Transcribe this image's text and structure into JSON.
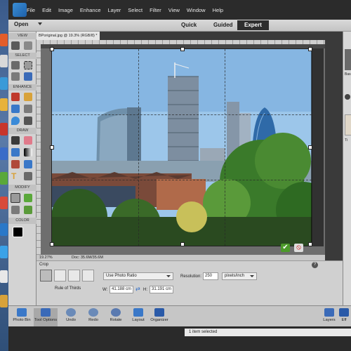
{
  "menu": [
    "File",
    "Edit",
    "Image",
    "Enhance",
    "Layer",
    "Select",
    "Filter",
    "View",
    "Window",
    "Help"
  ],
  "modebar": {
    "open": "Open",
    "quick": "Quick",
    "guided": "Guided",
    "expert": "Expert"
  },
  "panels": {
    "view": "VIEW",
    "select": "SELECT",
    "enhance": "ENHANCE",
    "draw": "DRAW",
    "modify": "MODIFY",
    "color": "COLOR"
  },
  "document": {
    "tab": "BPoriginal.jpg @ 19.3% (RGB/8) *",
    "zoom": "19.27%",
    "doc_size": "Doc: 35.6M/35.6M"
  },
  "options": {
    "title": "Crop",
    "overlay_label": "Rule of Thirds",
    "preset": "Use Photo Ratio",
    "w_label": "W:",
    "w_value": "41.188 cm",
    "h_label": "H:",
    "h_value": "31.191 cm",
    "resolution_label": "Resolution:",
    "resolution_value": "250",
    "resolution_unit": "pixels/inch",
    "help": "?"
  },
  "crop": {
    "commit": "✔",
    "cancel": "⦸"
  },
  "right_panel": {
    "label1": "Bas",
    "label2": "Ti"
  },
  "taskbar": [
    {
      "label": "Photo Bin",
      "icon": "photo-bin-icon"
    },
    {
      "label": "Tool Options",
      "icon": "tool-options-icon"
    },
    {
      "label": "Undo",
      "icon": "undo-icon"
    },
    {
      "label": "Redo",
      "icon": "redo-icon"
    },
    {
      "label": "Rotate",
      "icon": "rotate-icon"
    },
    {
      "label": "Layout",
      "icon": "layout-icon"
    },
    {
      "label": "Organizer",
      "icon": "organizer-icon"
    },
    {
      "label": "Layers",
      "icon": "layers-icon"
    },
    {
      "label": "Eff",
      "icon": "effects-icon"
    }
  ],
  "status": {
    "selected": "1 item selected"
  },
  "colors": {
    "accent": "#2e2e2e",
    "sky": "#9cc6ea",
    "tree": "#3a7a2a",
    "commit": "#4c9a2a"
  }
}
